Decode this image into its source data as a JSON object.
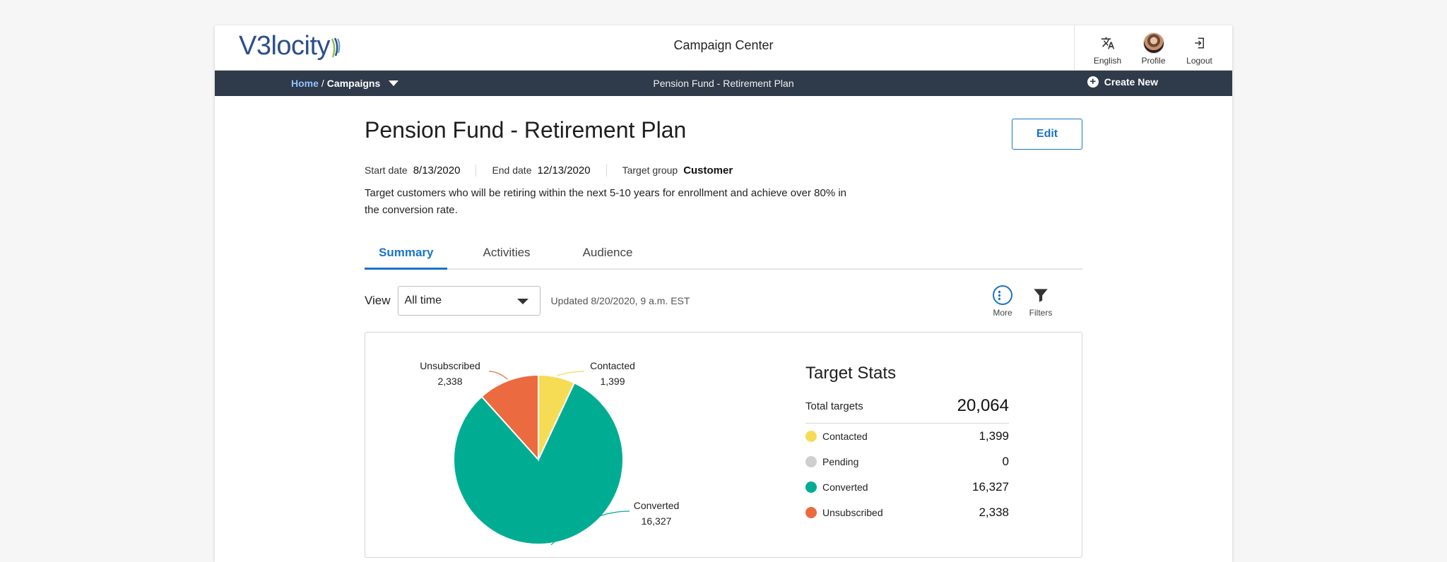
{
  "header": {
    "logo_text": "V3locity",
    "app_title": "Campaign Center",
    "actions": [
      {
        "label": "English",
        "icon": "translate-icon"
      },
      {
        "label": "Profile",
        "icon": "avatar"
      },
      {
        "label": "Logout",
        "icon": "logout-icon"
      }
    ]
  },
  "navbar": {
    "breadcrumb_home": "Home",
    "breadcrumb_sep": "/",
    "breadcrumb_current": "Campaigns",
    "center_title": "Pension Fund - Retirement Plan",
    "create_new_label": "Create New"
  },
  "campaign": {
    "title": "Pension Fund - Retirement Plan",
    "edit_label": "Edit",
    "start_label": "Start date",
    "start_value": "8/13/2020",
    "end_label": "End date",
    "end_value": "12/13/2020",
    "target_label": "Target group",
    "target_value": "Customer",
    "description": "Target customers who will be retiring within the next 5-10 years for enrollment and achieve over 80% in the conversion rate."
  },
  "tabs": [
    {
      "label": "Summary",
      "active": true
    },
    {
      "label": "Activities",
      "active": false
    },
    {
      "label": "Audience",
      "active": false
    }
  ],
  "toolbar": {
    "view_label": "View",
    "view_selected": "All time",
    "updated_text": "Updated 8/20/2020, 9 a.m. EST",
    "more_label": "More",
    "filters_label": "Filters"
  },
  "stats": {
    "title": "Target Stats",
    "total_label": "Total targets",
    "total_value": "20,064",
    "rows": [
      {
        "label": "Contacted",
        "value": "1,399",
        "color": "#f6dc55"
      },
      {
        "label": "Pending",
        "value": "0",
        "color": "#cfcfcf"
      },
      {
        "label": "Converted",
        "value": "16,327",
        "color": "#00ad93"
      },
      {
        "label": "Unsubscribed",
        "value": "2,338",
        "color": "#ec6a40"
      }
    ]
  },
  "chart_data": {
    "type": "pie",
    "categories": [
      "Contacted",
      "Converted",
      "Unsubscribed"
    ],
    "values": [
      1399,
      16327,
      2338
    ],
    "colors": [
      "#f6dc55",
      "#00ad93",
      "#ec6a40"
    ],
    "labels": [
      {
        "name": "Contacted",
        "value": "1,399"
      },
      {
        "name": "Converted",
        "value": "16,327"
      },
      {
        "name": "Unsubscribed",
        "value": "2,338"
      }
    ]
  }
}
